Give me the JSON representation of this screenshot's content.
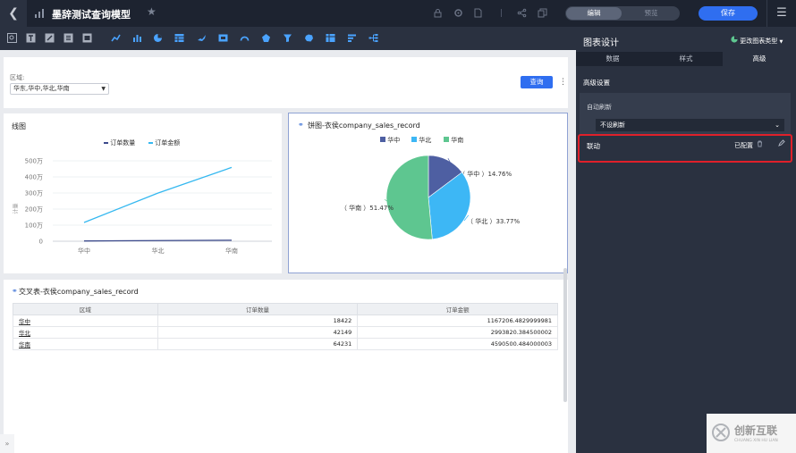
{
  "topbar": {
    "title": "墨辞测试查询模型",
    "mode_edit": "编辑",
    "mode_preview": "预览",
    "save_label": "保存"
  },
  "filter": {
    "label": "区域:",
    "value": "华东,华中,华北,华南",
    "query_label": "查询"
  },
  "line_chart": {
    "title": "线图",
    "legend": [
      "订单数量",
      "订单金额"
    ],
    "ylabel": "计量",
    "yticks": [
      "500万",
      "400万",
      "300万",
      "200万",
      "100万",
      "0"
    ],
    "categories": [
      "华中",
      "华北",
      "华南"
    ]
  },
  "pie_chart": {
    "title": "饼图-衣侯company_sales_record",
    "legend": [
      "华中",
      "华北",
      "华南"
    ],
    "labels": [
      "（ 华中 ）14.76%",
      "（ 华北 ）33.77%",
      "（ 华南 ）51.47%"
    ]
  },
  "chart_data": [
    {
      "type": "line",
      "title": "线图",
      "xlabel": "",
      "ylabel": "计量",
      "categories": [
        "华中",
        "华北",
        "华南"
      ],
      "ylim": [
        0,
        5500000
      ],
      "grid": true,
      "legend_position": "top",
      "series": [
        {
          "name": "订单数量",
          "values": [
            18422,
            42149,
            64231
          ],
          "color": "#3c4a8c"
        },
        {
          "name": "订单金额",
          "values": [
            1167206.4829999981,
            2993820.384500002,
            4590500.484000003
          ],
          "color": "#35b8f0"
        }
      ]
    },
    {
      "type": "pie",
      "title": "饼图-衣侯company_sales_record",
      "legend_position": "top",
      "series": [
        {
          "name": "华中",
          "value": 14.76,
          "color": "#4e5fa2"
        },
        {
          "name": "华北",
          "value": 33.77,
          "color": "#3db7f5"
        },
        {
          "name": "华南",
          "value": 51.47,
          "color": "#5ec690"
        }
      ]
    }
  ],
  "cross_table": {
    "title": "交叉表-衣侯company_sales_record",
    "columns": [
      "区域",
      "订单数量",
      "订单金额"
    ],
    "rows": [
      [
        "华中",
        "18422",
        "1167206.4829999981"
      ],
      [
        "华北",
        "42149",
        "2993820.384500002"
      ],
      [
        "华南",
        "64231",
        "4590500.484000003"
      ]
    ]
  },
  "right_panel": {
    "title": "图表设计",
    "change_type": "更改图表类型",
    "tabs": [
      "数据",
      "样式",
      "高级"
    ],
    "section": "高级设置",
    "auto_refresh_label": "自动刷新",
    "auto_refresh_value": "不设刷新",
    "linkage_label": "联动",
    "linkage_status": "已配置"
  },
  "watermark": {
    "brand": "创新互联",
    "sub": "CHUANG XIN HU LIAN"
  },
  "colors": {
    "accent": "#2f6ef0",
    "topbar": "#1d2330",
    "panel": "#2a3140",
    "highlight": "#e0202a"
  }
}
